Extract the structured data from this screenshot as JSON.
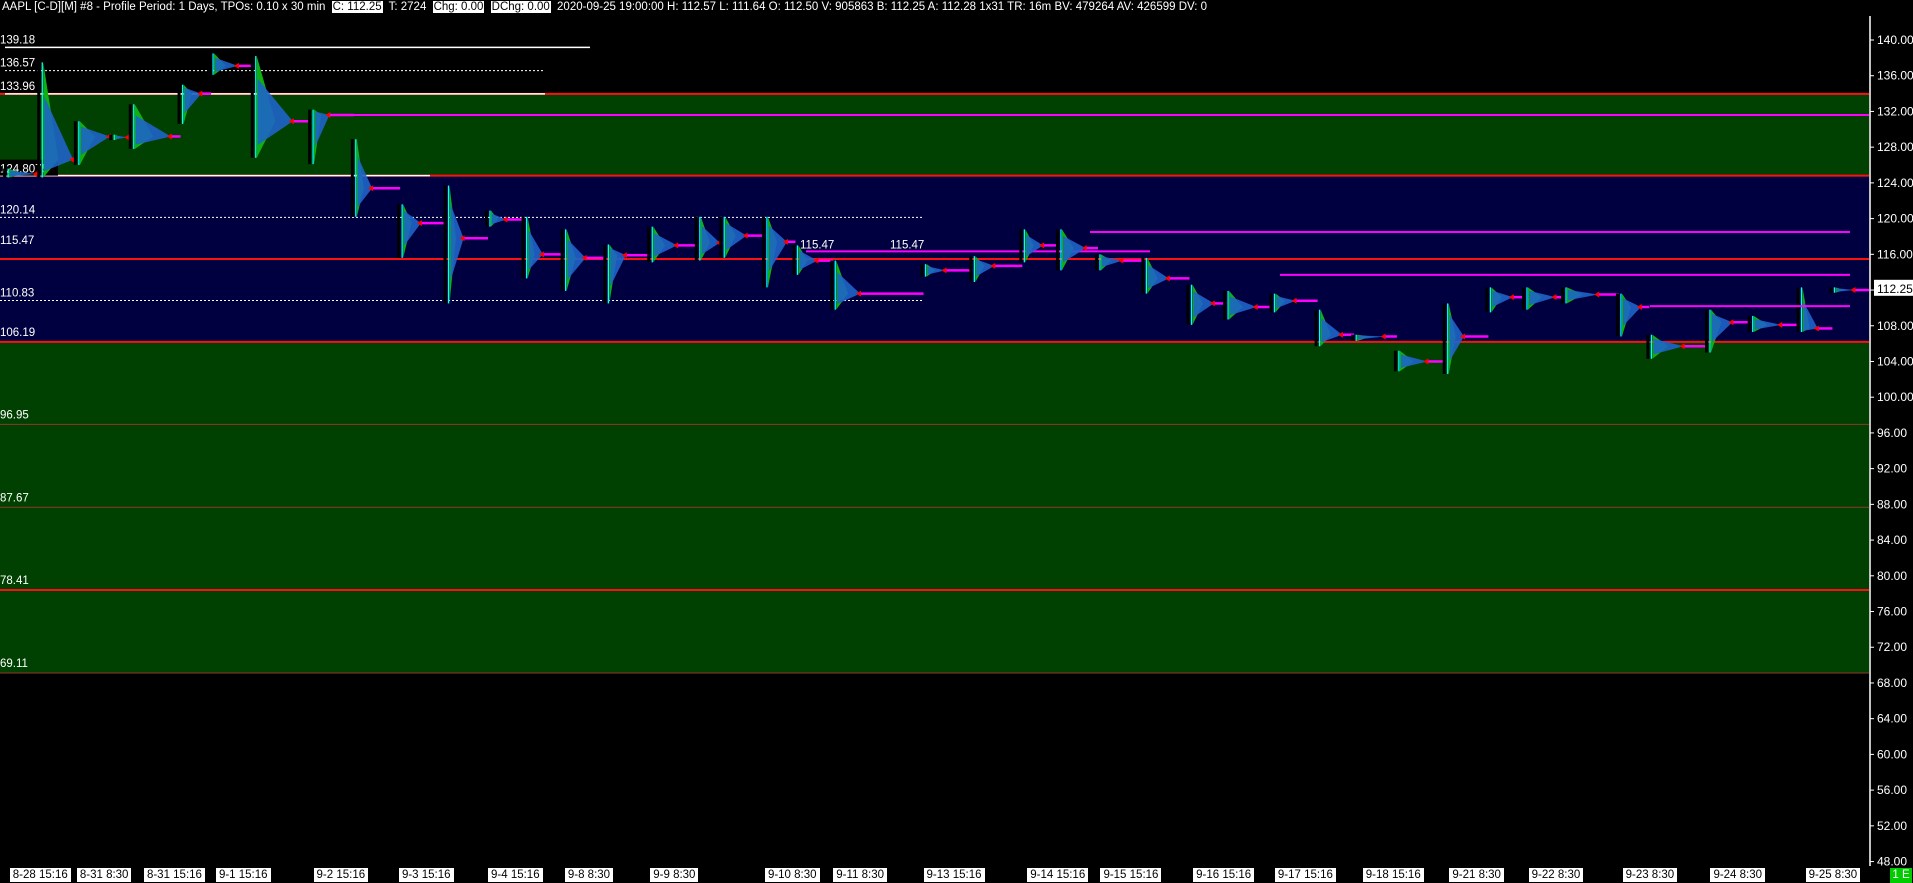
{
  "header": {
    "title": "AAPL [C-D][M]  #8 - Profile Period: 1 Days, TPOs: 0.10 x 30 min",
    "close": "C: 112.25",
    "trades": "T: 2724",
    "chg": "Chg: 0.00",
    "dchg": "DChg: 0.00",
    "stats": "2020-09-25 19:00:00 H: 112.57 L: 111.64 O: 112.50 V: 905863 B: 112.25 A: 112.28 1x31 TR: 16m BV: 479264 AV: 426599 DV: 0"
  },
  "colors": {
    "background": "#000000",
    "green_zone": "#004000",
    "value_zone": "#000040",
    "red_level": "#ff1010",
    "poc_line": "#ff00ff",
    "profile_green": "#10b010",
    "profile_blue": "#1e64c8",
    "profile_cyan": "#00ffff"
  },
  "current_price_label": "112.25",
  "corner_badge": "1 E",
  "chart_data": {
    "type": "market-profile",
    "symbol": "AAPL",
    "ylim": [
      48,
      142
    ],
    "y_ticks": [
      "140.00",
      "136.00",
      "132.00",
      "128.00",
      "124.00",
      "120.00",
      "116.00",
      "112.00",
      "108.00",
      "104.00",
      "100.00",
      "96.00",
      "92.00",
      "88.00",
      "84.00",
      "80.00",
      "76.00",
      "72.00",
      "68.00",
      "64.00",
      "60.00",
      "56.00",
      "52.00",
      "48.00"
    ],
    "x_labels": [
      "8-28 15:16",
      "8-31 8:30",
      "8-31 15:16",
      "9-1 15:16",
      "9-2 15:16",
      "9-3 15:16",
      "9-4 15:16",
      "9-8 8:30",
      "9-9 8:30",
      "9-10 8:30",
      "9-11 8:30",
      "9-13 15:16",
      "9-14 15:16",
      "9-15 15:16",
      "9-16 15:16",
      "9-17 15:16",
      "9-18 15:16",
      "9-21 8:30",
      "9-22 8:30",
      "9-23 8:30",
      "9-24 8:30",
      "9-25 8:30"
    ],
    "zones": [
      {
        "from": 133.96,
        "to": 124.8075,
        "kind": "green"
      },
      {
        "from": 124.8075,
        "to": 106.19,
        "kind": "value"
      },
      {
        "from": 106.19,
        "to": 69.11,
        "kind": "green"
      }
    ],
    "levels": [
      {
        "price": 139.18,
        "label": "139.18",
        "style": "white"
      },
      {
        "price": 136.57,
        "label": "136.57",
        "style": "dotted"
      },
      {
        "price": 133.96,
        "label": "133.96",
        "style": "red"
      },
      {
        "price": 124.8075,
        "label": "124.8075",
        "style": "red"
      },
      {
        "price": 120.14,
        "label": "120.14",
        "style": "dotted"
      },
      {
        "price": 115.47,
        "label": "115.47",
        "style": "red"
      },
      {
        "price": 110.83,
        "label": "110.83",
        "style": "dotted"
      },
      {
        "price": 106.19,
        "label": "106.19",
        "style": "red"
      },
      {
        "price": 96.95,
        "label": "96.95",
        "style": "thin"
      },
      {
        "price": 87.67,
        "label": "87.67",
        "style": "thin"
      },
      {
        "price": 78.41,
        "label": "78.41",
        "style": "red"
      },
      {
        "price": 69.11,
        "label": "69.11",
        "style": "thin"
      }
    ],
    "extra_labels": [
      "115.47",
      "115.47"
    ],
    "profiles": [
      {
        "high": 125.6,
        "low": 124.6,
        "poc": 125.0
      },
      {
        "high": 137.5,
        "low": 124.6,
        "poc": 126.6
      },
      {
        "high": 130.9,
        "low": 126.0,
        "poc": 129.2
      },
      {
        "high": 129.4,
        "low": 128.8,
        "poc": 129.1
      },
      {
        "high": 132.8,
        "low": 127.8,
        "poc": 129.2
      },
      {
        "high": 135.0,
        "low": 130.6,
        "poc": 134.0
      },
      {
        "high": 138.5,
        "low": 136.1,
        "poc": 137.1
      },
      {
        "high": 138.2,
        "low": 126.8,
        "poc": 130.9
      },
      {
        "high": 132.2,
        "low": 126.1,
        "poc": 131.6
      },
      {
        "high": 128.9,
        "low": 120.2,
        "poc": 123.4
      },
      {
        "high": 121.6,
        "low": 115.6,
        "poc": 119.5
      },
      {
        "high": 123.7,
        "low": 110.5,
        "poc": 117.8
      },
      {
        "high": 120.9,
        "low": 119.1,
        "poc": 119.9
      },
      {
        "high": 120.2,
        "low": 113.3,
        "poc": 116.0
      },
      {
        "high": 118.8,
        "low": 111.9,
        "poc": 115.6
      },
      {
        "high": 117.1,
        "low": 110.5,
        "poc": 115.9
      },
      {
        "high": 119.1,
        "low": 115.1,
        "poc": 117.0
      },
      {
        "high": 120.2,
        "low": 115.3,
        "poc": 117.3
      },
      {
        "high": 120.2,
        "low": 115.6,
        "poc": 118.1
      },
      {
        "high": 120.2,
        "low": 112.3,
        "poc": 117.4
      },
      {
        "high": 117.0,
        "low": 113.7,
        "poc": 115.3
      },
      {
        "high": 115.3,
        "low": 109.8,
        "poc": 111.6
      },
      {
        "high": 114.9,
        "low": 113.5,
        "poc": 114.2
      },
      {
        "high": 115.8,
        "low": 112.9,
        "poc": 114.7
      },
      {
        "high": 118.8,
        "low": 115.1,
        "poc": 117.0
      },
      {
        "high": 118.8,
        "low": 114.2,
        "poc": 116.7
      },
      {
        "high": 116.0,
        "low": 114.2,
        "poc": 115.3
      },
      {
        "high": 115.6,
        "low": 111.6,
        "poc": 113.3
      },
      {
        "high": 112.6,
        "low": 108.1,
        "poc": 110.5
      },
      {
        "high": 111.9,
        "low": 108.7,
        "poc": 110.1
      },
      {
        "high": 111.6,
        "low": 109.5,
        "poc": 110.8
      },
      {
        "high": 109.8,
        "low": 105.7,
        "poc": 107.0
      },
      {
        "high": 107.0,
        "low": 106.3,
        "poc": 106.8
      },
      {
        "high": 105.2,
        "low": 102.9,
        "poc": 104.0
      },
      {
        "high": 110.5,
        "low": 102.6,
        "poc": 106.8
      },
      {
        "high": 112.3,
        "low": 109.5,
        "poc": 111.2
      },
      {
        "high": 112.3,
        "low": 109.8,
        "poc": 111.2
      },
      {
        "high": 112.3,
        "low": 110.5,
        "poc": 111.5
      },
      {
        "high": 111.6,
        "low": 106.8,
        "poc": 110.1
      },
      {
        "high": 107.0,
        "low": 104.3,
        "poc": 105.7
      },
      {
        "high": 109.8,
        "low": 105.0,
        "poc": 108.4
      },
      {
        "high": 109.1,
        "low": 107.3,
        "poc": 108.1
      },
      {
        "high": 112.3,
        "low": 107.3,
        "poc": 107.7
      },
      {
        "high": 112.3,
        "low": 111.7,
        "poc": 112.0
      }
    ],
    "naked_poc_extensions": [
      131.6,
      118.5,
      113.7,
      110.2
    ],
    "current_price": 112.25
  }
}
